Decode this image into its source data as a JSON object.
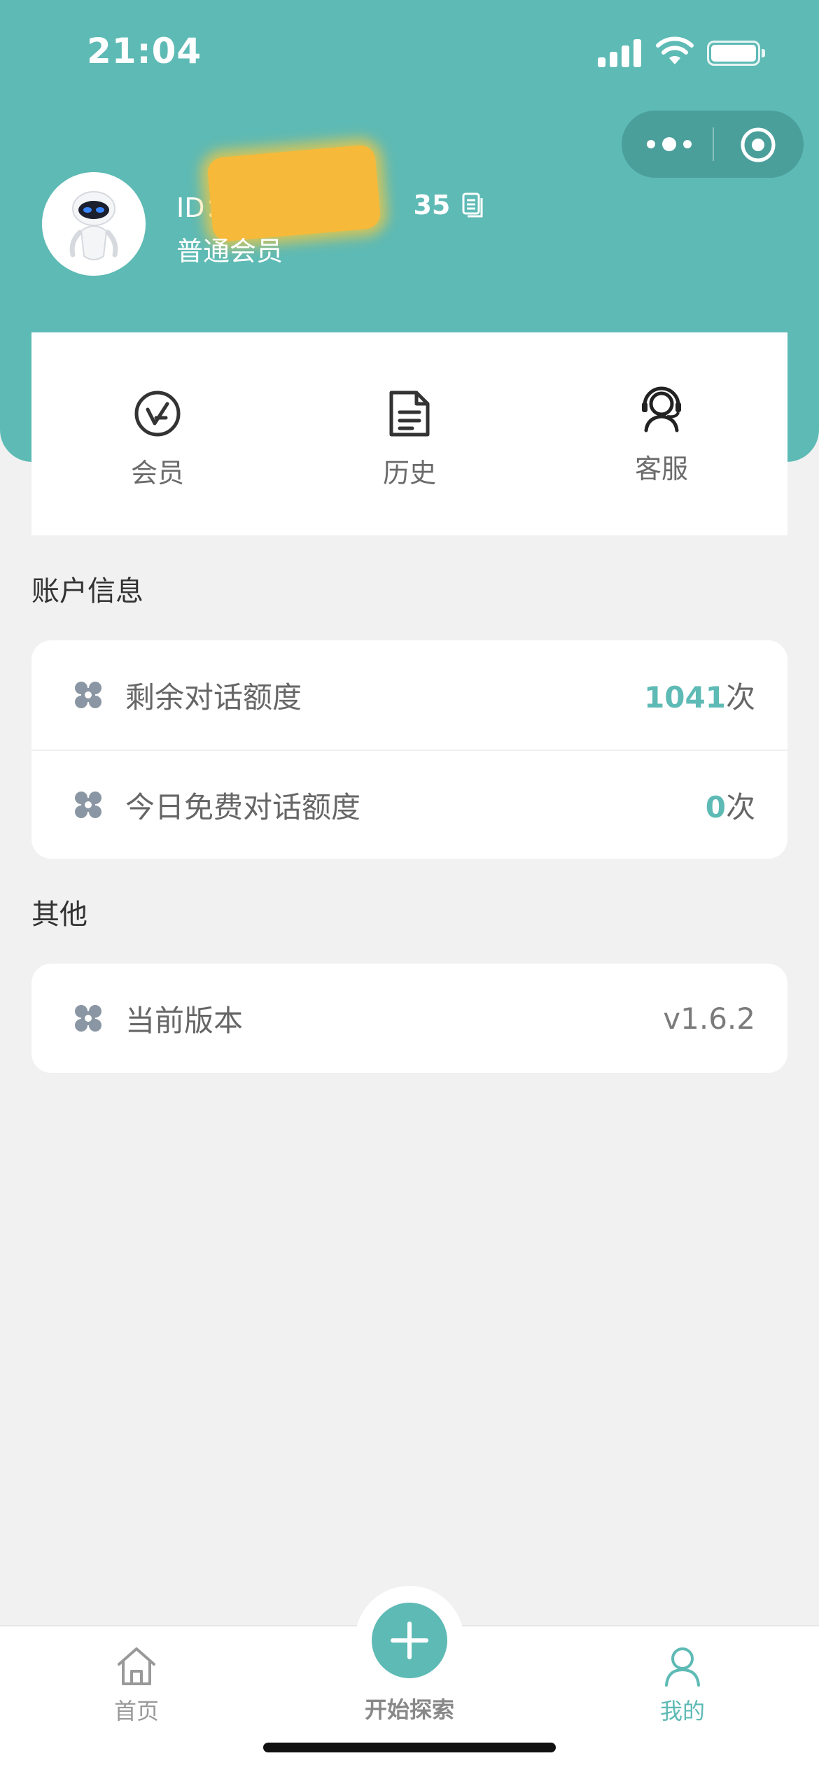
{
  "status_bar": {
    "time": "21:04"
  },
  "profile": {
    "id_prefix": "ID：",
    "id_suffix": "35",
    "member_level": "普通会员"
  },
  "quick_actions": [
    {
      "label": "会员",
      "icon": "membership-v-icon"
    },
    {
      "label": "历史",
      "icon": "document-history-icon"
    },
    {
      "label": "客服",
      "icon": "customer-service-headset-icon"
    }
  ],
  "account_section": {
    "title": "账户信息",
    "rows": [
      {
        "label": "剩余对话额度",
        "value": "1041",
        "unit": "次"
      },
      {
        "label": "今日免费对话额度",
        "value": "0",
        "unit": "次"
      }
    ]
  },
  "other_section": {
    "title": "其他",
    "rows": [
      {
        "label": "当前版本",
        "value": "v1.6.2"
      }
    ]
  },
  "tabbar": {
    "home_label": "首页",
    "explore_label": "开始探索",
    "mine_label": "我的"
  },
  "colors": {
    "accent": "#5ebab5",
    "background": "#f1f1f1",
    "card": "#ffffff"
  }
}
